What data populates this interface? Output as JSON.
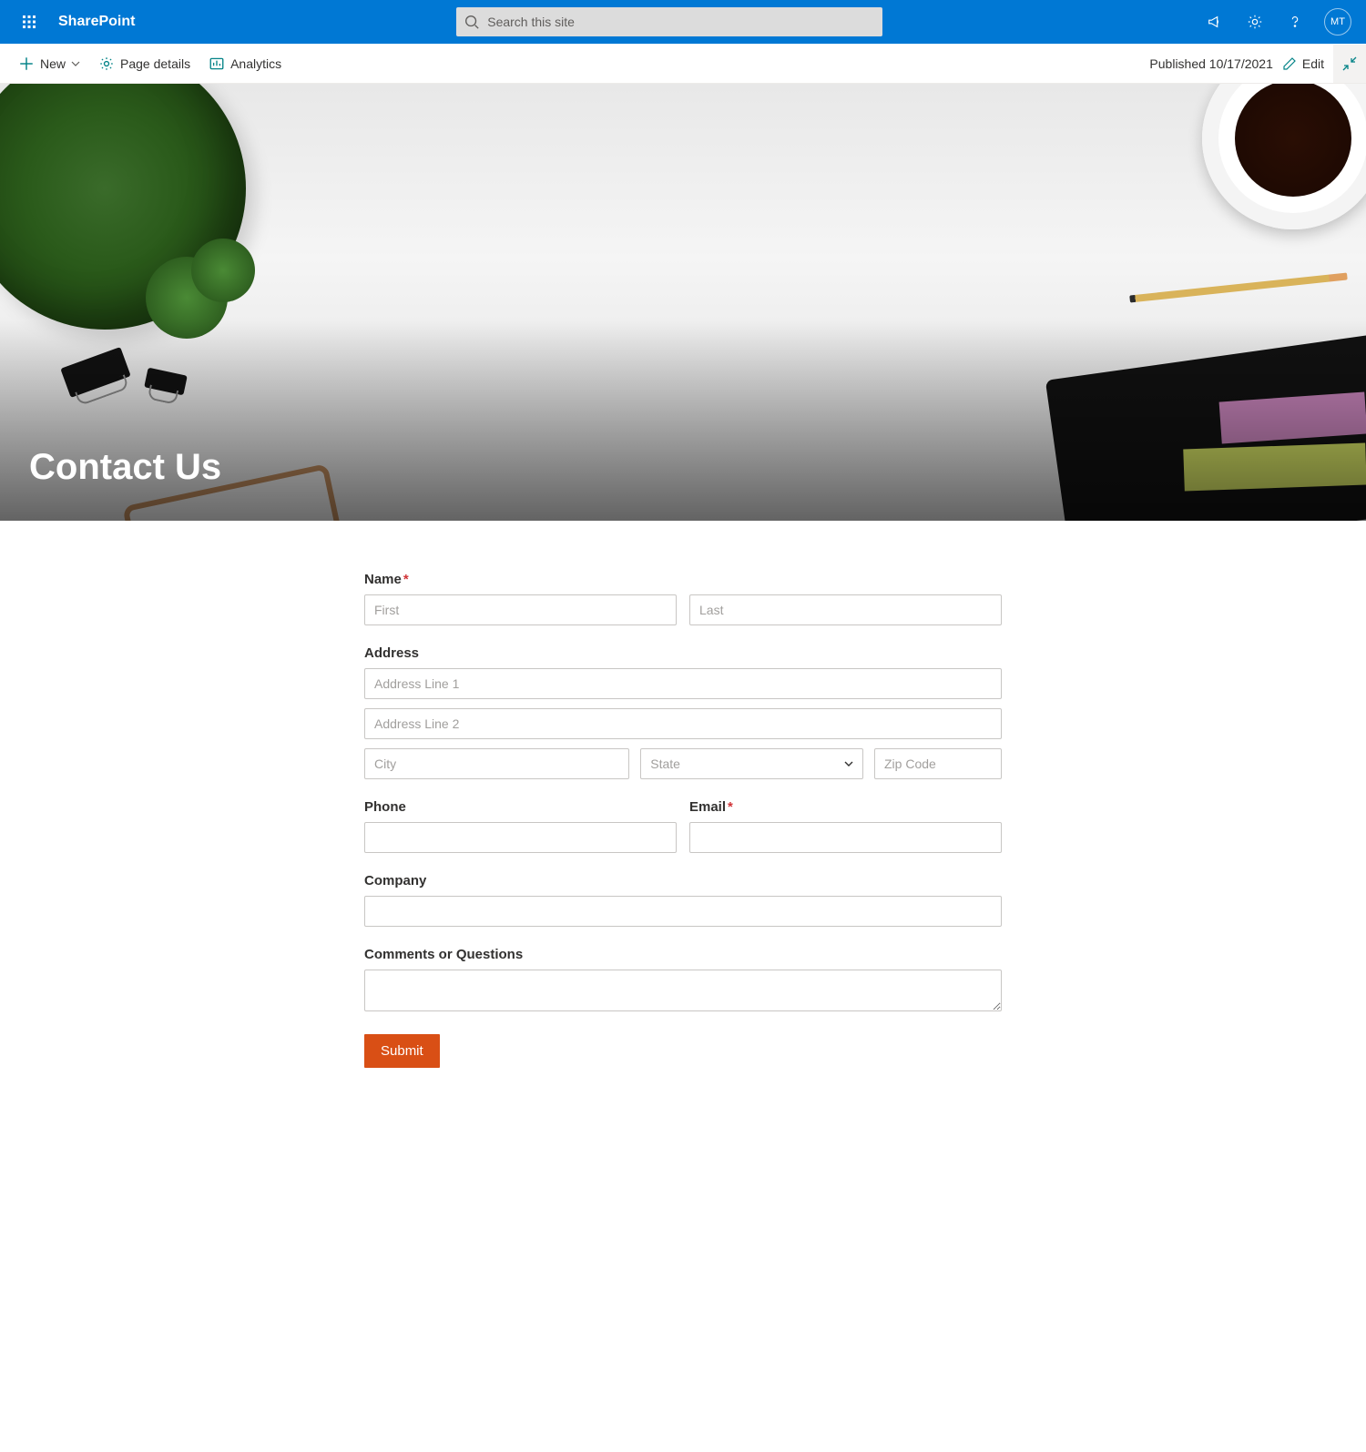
{
  "topbar": {
    "brand": "SharePoint",
    "search_placeholder": "Search this site",
    "avatar_initials": "MT"
  },
  "cmdbar": {
    "new_label": "New",
    "page_details_label": "Page details",
    "analytics_label": "Analytics",
    "published_label": "Published 10/17/2021",
    "edit_label": "Edit"
  },
  "hero": {
    "title": "Contact Us"
  },
  "form": {
    "name_label": "Name",
    "first_ph": "First",
    "last_ph": "Last",
    "address_label": "Address",
    "addr1_ph": "Address Line 1",
    "addr2_ph": "Address Line 2",
    "city_ph": "City",
    "state_ph": "State",
    "zip_ph": "Zip Code",
    "phone_label": "Phone",
    "email_label": "Email",
    "company_label": "Company",
    "comments_label": "Comments or Questions",
    "submit_label": "Submit"
  }
}
